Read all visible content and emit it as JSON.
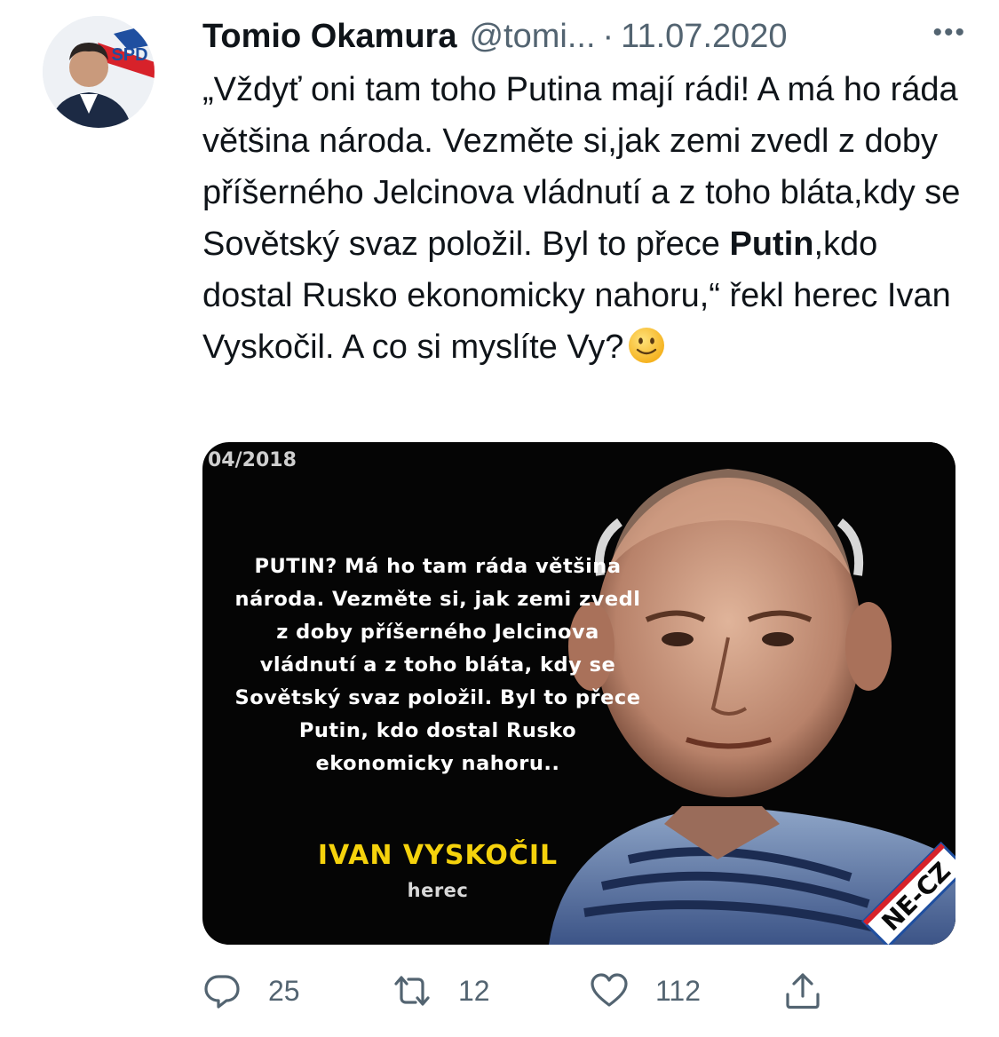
{
  "tweet": {
    "author_name": "Tomio Okamura",
    "handle": "@tomi...",
    "separator": "·",
    "date": "11.07.2020",
    "more_label": "•••",
    "avatar_badge": "SPD",
    "text_part1": "„Vždyť oni tam toho Putina mají rádi! A má ho ráda většina národa. Vezměte si,jak zemi zvedl z doby příšerného Jelcinova vládnutí a z toho bláta,kdy se Sovětský svaz položil. Byl to přece ",
    "text_bold": "Putin",
    "text_part2": ",kdo dostal Rusko ekonomicky nahoru,“ řekl herec Ivan Vyskočil. A co si myslíte Vy?",
    "emoji": "slightly-smiling-face"
  },
  "media": {
    "date_label": "04/2018",
    "quote": "PUTIN? Má ho tam ráda většina\nnároda. Vezměte si, jak zemi zvedl\nz doby příšerného Jelcinova\nvládnutí a z toho bláta, kdy se\nSovětský svaz položil. Byl to přece\nPutin, kdo dostal Rusko\nekonomicky nahoru..",
    "author": "IVAN VYSKOČIL",
    "role": "herec",
    "watermark": "NE-CZ"
  },
  "actions": {
    "reply_count": "25",
    "retweet_count": "12",
    "like_count": "112"
  },
  "colors": {
    "text": "#0f1419",
    "secondary": "#536471",
    "media_bg": "#050505",
    "author_yellow": "#f5d20c"
  }
}
